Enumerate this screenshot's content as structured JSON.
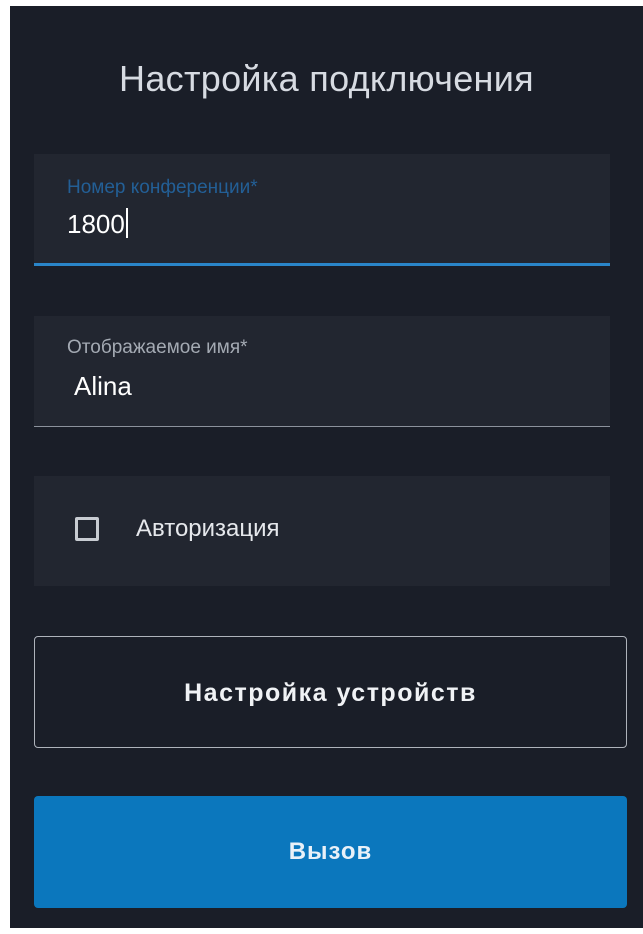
{
  "dialog": {
    "title": "Настройка подключения"
  },
  "conference_field": {
    "label": "Номер конференции*",
    "value": "1800",
    "focused": true,
    "accent_color": "#2a85c9"
  },
  "name_field": {
    "label": "Отображаемое имя*",
    "value": "Alina"
  },
  "authorization": {
    "label": "Авторизация",
    "checked": false
  },
  "buttons": {
    "devices_label": "Настройка устройств",
    "call_label": "Вызов",
    "call_color": "#0b77bd"
  }
}
